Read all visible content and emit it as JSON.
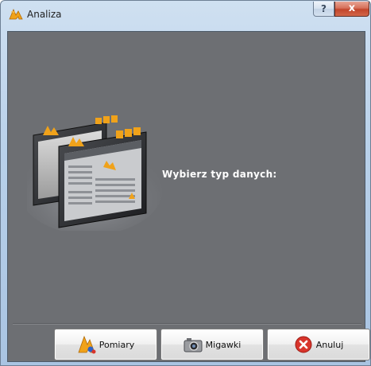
{
  "window": {
    "title": "Analiza",
    "help_label": "?",
    "close_label": "x"
  },
  "main": {
    "prompt": "Wybierz typ danych:"
  },
  "buttons": {
    "pomiary": "Pomiary",
    "migawki": "Migawki",
    "anuluj": "Anuluj"
  },
  "colors": {
    "client_bg": "#6d6f73",
    "accent": "#f0a21a",
    "cancel_red": "#d8342b"
  }
}
